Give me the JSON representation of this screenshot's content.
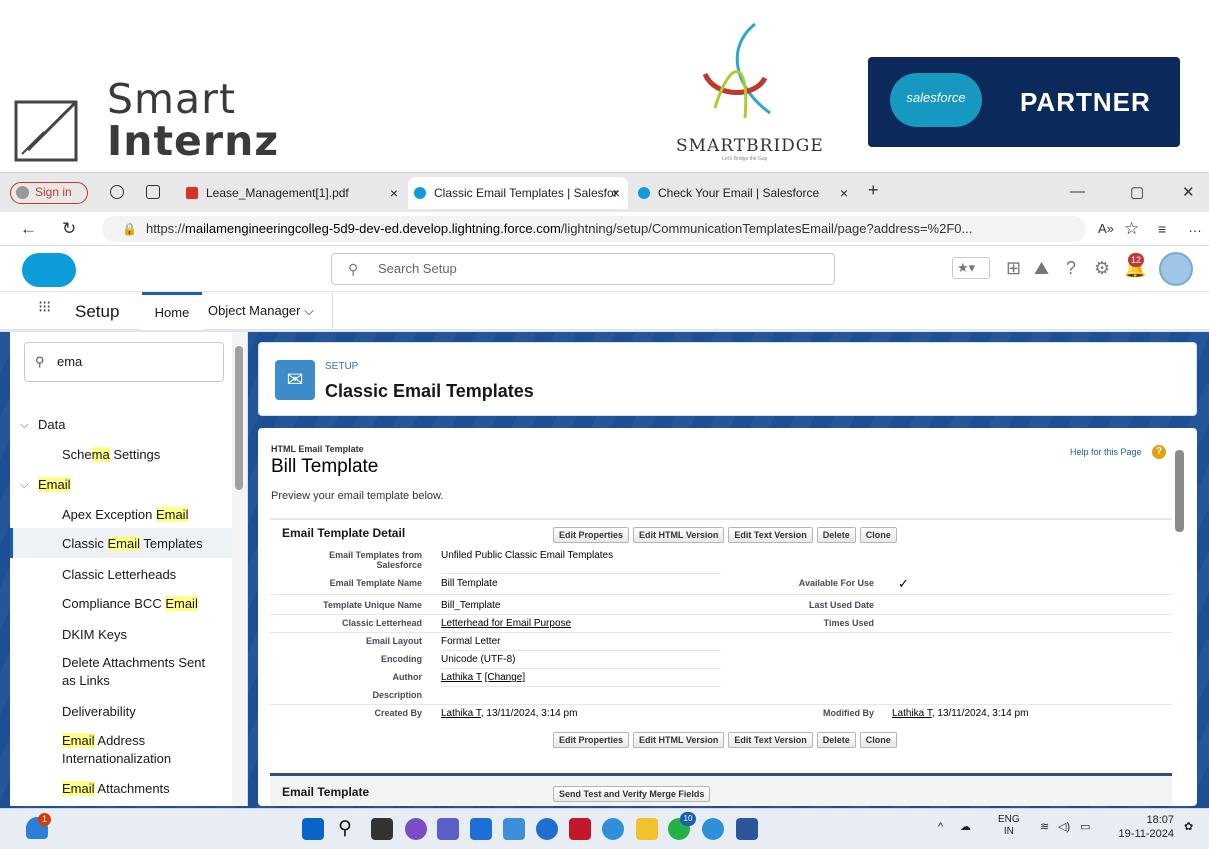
{
  "logos": {
    "smart": "Smart",
    "internz": "Internz",
    "smartbridge": "SMARTBRIDGE",
    "smartbridge_tag": "Let's Bridge the Gap",
    "salesforce": "salesforce",
    "partner": "PARTNER"
  },
  "browser": {
    "signin": "Sign in",
    "tabs": [
      {
        "label": "Lease_Management[1].pdf",
        "close": "×"
      },
      {
        "label": "Classic Email Templates | Salesfor",
        "close": "×"
      },
      {
        "label": "Check Your Email | Salesforce",
        "close": "×"
      }
    ],
    "new_tab": "+",
    "url_prefix": "https://",
    "url_host": "mailamengineeringcolleg-5d9-dev-ed.develop.lightning.force.com",
    "url_path": "/lightning/setup/CommunicationTemplatesEmail/page?address=%2F0...",
    "minimize": "—",
    "restore": "▢",
    "close": "✕"
  },
  "sf": {
    "search_placeholder": "Search Setup",
    "notif_count": "12",
    "app_label": "Setup",
    "nav_home": "Home",
    "nav_object_manager": "Object Manager"
  },
  "sidebar": {
    "quick_find": "ema",
    "items": [
      {
        "label": "Data",
        "type": "section"
      },
      {
        "label_pre": "Sche",
        "label_hl": "ma",
        "label_post": " Settings"
      },
      {
        "label_pre": "",
        "label_hl": "Email",
        "label_post": "",
        "type": "section"
      },
      {
        "label_pre": "Apex Exception ",
        "label_hl": "Email",
        "label_post": ""
      },
      {
        "label_pre": "Classic ",
        "label_hl": "Email",
        "label_post": " Templates"
      },
      {
        "label_pre": "Classic Letterheads",
        "label_hl": "",
        "label_post": ""
      },
      {
        "label_pre": "Compliance BCC ",
        "label_hl": "Email",
        "label_post": ""
      },
      {
        "label_pre": "DKIM Keys",
        "label_hl": "",
        "label_post": ""
      },
      {
        "label_pre": "Delete Attachments Sent as Links",
        "label_hl": "",
        "label_post": ""
      },
      {
        "label_pre": "Deliverability",
        "label_hl": "",
        "label_post": ""
      },
      {
        "label_pre": "",
        "label_hl": "Email",
        "label_post": " Address Internationalization"
      },
      {
        "label_pre": "",
        "label_hl": "Email",
        "label_post": " Attachments"
      }
    ]
  },
  "page": {
    "setup_small": "SETUP",
    "title": "Classic Email Templates",
    "template_type": "HTML Email Template",
    "template_title": "Bill Template",
    "help": "Help for this Page",
    "preview": "Preview your email template below.",
    "detail_heading": "Email Template Detail",
    "buttons": [
      "Edit Properties",
      "Edit HTML Version",
      "Edit Text Version",
      "Delete",
      "Clone"
    ],
    "fields": {
      "folder_label": "Email Templates from Salesforce",
      "folder_value": "Unfiled Public Classic Email Templates",
      "name_label": "Email Template Name",
      "name_value": "Bill Template",
      "available_label": "Available For Use",
      "available_value": "✓",
      "unique_label": "Template Unique Name",
      "unique_value": "Bill_Template",
      "last_used_label": "Last Used Date",
      "letterhead_label": "Classic Letterhead",
      "letterhead_value": "Letterhead for Email Purpose",
      "times_used_label": "Times Used",
      "layout_label": "Email Layout",
      "layout_value": "Formal Letter",
      "encoding_label": "Encoding",
      "encoding_value": "Unicode (UTF-8)",
      "author_label": "Author",
      "author_value": "Lathika T",
      "author_change": "[Change]",
      "description_label": "Description",
      "created_label": "Created By",
      "created_user": "Lathika T",
      "created_date": ", 13/11/2024, 3:14 pm",
      "modified_label": "Modified By",
      "modified_user": "Lathika T",
      "modified_date": ", 13/11/2024, 3:14 pm"
    },
    "email_template_heading": "Email Template",
    "send_test_button": "Send Test and Verify Merge Fields"
  },
  "taskbar": {
    "weather_badge": "1",
    "whatsapp_badge": "10",
    "lang": "ENG",
    "region": "IN",
    "time": "18:07",
    "date": "19-11-2024"
  },
  "colors": {
    "sf_blue": "#1c4f94",
    "link_blue": "#1b5fb3",
    "highlight": "#fffe89",
    "partner_bg": "#0b2a5b"
  }
}
